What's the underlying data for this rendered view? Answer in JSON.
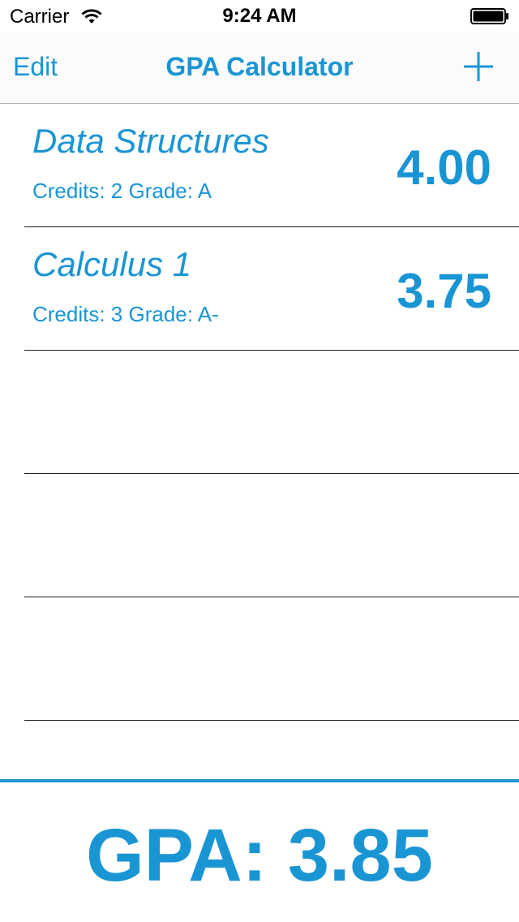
{
  "status_bar": {
    "carrier": "Carrier",
    "time": "9:24 AM",
    "wifi_icon": "wifi-icon",
    "battery_icon": "battery-icon",
    "battery_level": 1.0
  },
  "nav": {
    "edit_label": "Edit",
    "title": "GPA Calculator",
    "add_icon": "plus-icon"
  },
  "courses": [
    {
      "name": "Data Structures",
      "credits_label": "Credits: 2",
      "grade_label": "Grade: A",
      "gpa": "4.00"
    },
    {
      "name": "Calculus 1",
      "credits_label": "Credits: 3",
      "grade_label": "Grade: A-",
      "gpa": "3.75"
    }
  ],
  "empty_rows": 3,
  "footer": {
    "gpa_prefix": "GPA:",
    "gpa_value": "3.85"
  },
  "colors": {
    "accent": "#1a95d4",
    "separator": "#1b1b1b",
    "nav_border": "#b2b2b2"
  }
}
